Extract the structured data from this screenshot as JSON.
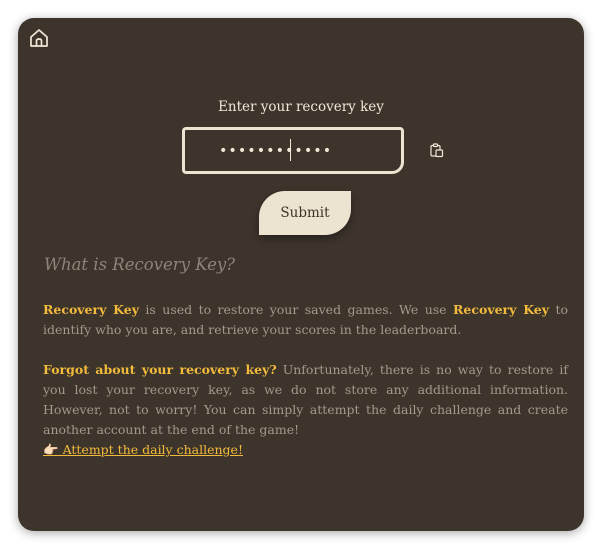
{
  "home": {
    "icon": "home-icon"
  },
  "recovery": {
    "prompt": "Enter your recovery key",
    "input_value": "••••••••••••",
    "paste_icon": "paste-icon",
    "submit_label": "Submit"
  },
  "faq": {
    "title": "What is Recovery Key?",
    "p1": {
      "hl1": "Recovery Key",
      "t1": " is used to restore your saved games. We use ",
      "hl2": "Recovery Key",
      "t2": " to identify who you are, and retrieve your scores in the leaderboard."
    },
    "p2": {
      "hl1": "Forgot about your recovery key?",
      "t1": " Unfortunately, there is no way to restore if you lost your recovery key, as we do not store any additional information. However, not to worry! You can simply attempt the daily challenge and create another account at the end of the game!"
    },
    "challenge_icon": "👉🏻",
    "challenge_link": "Attempt the daily challenge!"
  },
  "colors": {
    "card_bg": "#3d342c",
    "accent": "#f3bb3c",
    "cream": "#ece3d0",
    "muted_text": "#a39a8c"
  }
}
